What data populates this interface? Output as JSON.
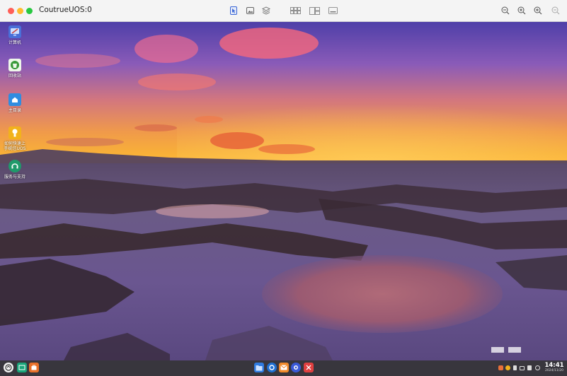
{
  "window": {
    "title": "CoutrueUOS:0",
    "traffic_lights": {
      "close": "#ff5f57",
      "minimize": "#febc2e",
      "maximize": "#28c840"
    },
    "toolbar_icons": [
      "pointer-icon",
      "image-icon",
      "layers-icon",
      "grid-icon",
      "split-icon",
      "display-icon",
      "zoom-out-icon",
      "zoom-in-icon",
      "zoom-fit-icon",
      "zoom-actual-icon"
    ]
  },
  "desktop": {
    "icons": [
      {
        "name": "computer",
        "label": "计算机",
        "color": "#4a6fd8"
      },
      {
        "name": "trash",
        "label": "回收站",
        "color": "#3a9a3a"
      },
      {
        "name": "home",
        "label": "主目录",
        "color": "#2f8ce0"
      },
      {
        "name": "guide",
        "label": "如何快速上\n手统信UOS",
        "color": "#f2b21c"
      },
      {
        "name": "support",
        "label": "服务与支持",
        "color": "#1f9a6a"
      }
    ]
  },
  "taskbar": {
    "left_icons": [
      "launcher-icon",
      "multitask-view-icon",
      "app-store-icon"
    ],
    "center_icons": [
      "file-manager-icon",
      "browser-icon",
      "mail-icon",
      "settings-icon",
      "app-center-icon"
    ],
    "tray_icons": [
      "notification-icon",
      "color-icon",
      "pen-icon",
      "battery-icon",
      "volume-icon",
      "power-icon"
    ],
    "time": "14:41",
    "date": "2024/11/20"
  }
}
